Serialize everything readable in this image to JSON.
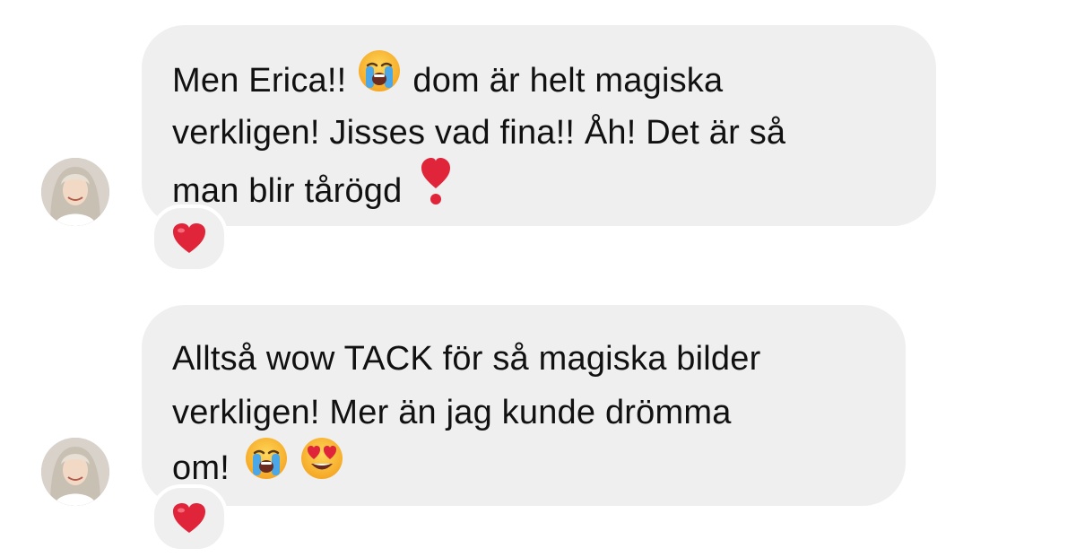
{
  "messages": [
    {
      "avatar_icon": "user-avatar-icon",
      "lines": [
        {
          "before": "Men Erica!!",
          "emoji": "loudly-crying-face",
          "after": "dom är helt magiska"
        },
        {
          "text": "verkligen! Jisses vad fina!! Åh! Det är så"
        },
        {
          "before": "man blir tårögd",
          "emoji": "heavy-exclamation-heart",
          "after": ""
        }
      ],
      "reaction": "red-heart"
    },
    {
      "avatar_icon": "user-avatar-icon",
      "lines": [
        {
          "text": "Alltså wow TACK för så magiska bilder"
        },
        {
          "text": "verkligen! Mer än jag kunde drömma"
        },
        {
          "before": "om!",
          "emoji": "loudly-crying-face",
          "emoji2": "smiling-face-with-heart-eyes"
        }
      ],
      "reaction": "red-heart"
    }
  ],
  "colors": {
    "bubble": "#efefef",
    "text": "#111111",
    "heart": "#e0243a"
  }
}
